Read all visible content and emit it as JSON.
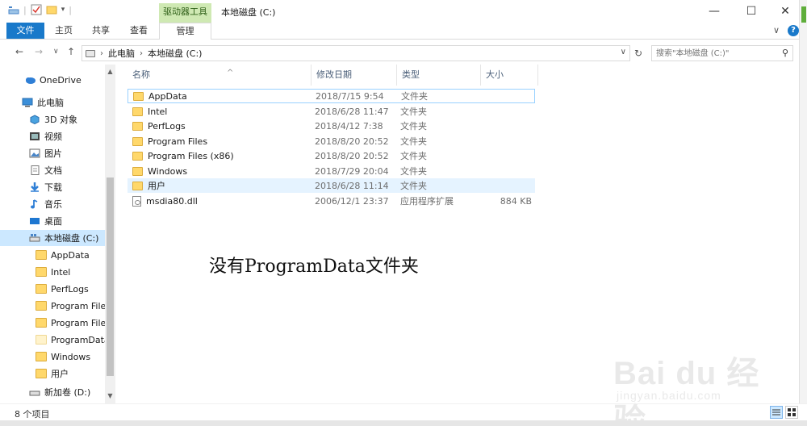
{
  "window": {
    "title": "本地磁盘 (C:)",
    "context_tab_group": "驱动器工具",
    "minimize_glyph": "—",
    "maximize_glyph": "☐",
    "close_glyph": "✕"
  },
  "ribbon": {
    "tabs": [
      "文件",
      "主页",
      "共享",
      "查看",
      "管理"
    ],
    "expand_glyph": "∨",
    "help_glyph": "?"
  },
  "address": {
    "back_glyph": "←",
    "forward_glyph": "→",
    "recent_glyph": "∨",
    "up_glyph": "↑",
    "crumbs": [
      "此电脑",
      "本地磁盘 (C:)"
    ],
    "crumb_sep": "›",
    "dropdown_glyph": "∨",
    "refresh_glyph": "↻",
    "search_placeholder": "搜索\"本地磁盘 (C:)\"",
    "search_glyph": "⚲"
  },
  "navpane": {
    "items": [
      {
        "label": "OneDrive",
        "icon": "cloud-icon"
      },
      {
        "label": "此电脑",
        "icon": "computer-icon"
      },
      {
        "label": "3D 对象",
        "icon": "cube-icon"
      },
      {
        "label": "视频",
        "icon": "video-icon"
      },
      {
        "label": "图片",
        "icon": "picture-icon"
      },
      {
        "label": "文档",
        "icon": "document-icon"
      },
      {
        "label": "下载",
        "icon": "download-icon"
      },
      {
        "label": "音乐",
        "icon": "music-icon"
      },
      {
        "label": "桌面",
        "icon": "desktop-icon"
      },
      {
        "label": "本地磁盘 (C:)",
        "icon": "drive-icon"
      },
      {
        "label": "AppData",
        "icon": "folder-icon"
      },
      {
        "label": "Intel",
        "icon": "folder-icon"
      },
      {
        "label": "PerfLogs",
        "icon": "folder-icon"
      },
      {
        "label": "Program Files",
        "icon": "folder-icon"
      },
      {
        "label": "Program Files",
        "icon": "folder-icon"
      },
      {
        "label": "ProgramData",
        "icon": "folder-icon"
      },
      {
        "label": "Windows",
        "icon": "folder-icon"
      },
      {
        "label": "用户",
        "icon": "folder-icon"
      },
      {
        "label": "新加卷 (D:)",
        "icon": "drive-icon"
      }
    ],
    "scroll_up_glyph": "▲",
    "scroll_down_glyph": "▼"
  },
  "columns": {
    "name": "名称",
    "date": "修改日期",
    "type": "类型",
    "size": "大小",
    "sort_glyph": "^"
  },
  "files": [
    {
      "name": "AppData",
      "date": "2018/7/15 9:54",
      "type": "文件夹",
      "size": ""
    },
    {
      "name": "Intel",
      "date": "2018/6/28 11:47",
      "type": "文件夹",
      "size": ""
    },
    {
      "name": "PerfLogs",
      "date": "2018/4/12 7:38",
      "type": "文件夹",
      "size": ""
    },
    {
      "name": "Program Files",
      "date": "2018/8/20 20:52",
      "type": "文件夹",
      "size": ""
    },
    {
      "name": "Program Files (x86)",
      "date": "2018/8/20 20:52",
      "type": "文件夹",
      "size": ""
    },
    {
      "name": "Windows",
      "date": "2018/7/29 20:04",
      "type": "文件夹",
      "size": ""
    },
    {
      "name": "用户",
      "date": "2018/6/28 11:14",
      "type": "文件夹",
      "size": ""
    },
    {
      "name": "msdia80.dll",
      "date": "2006/12/1 23:37",
      "type": "应用程序扩展",
      "size": "884 KB"
    }
  ],
  "annotation": "没有ProgramData文件夹",
  "watermark": {
    "main": "Bai du 经验",
    "sub": "jingyan.baidu.com"
  },
  "status": {
    "item_count": "8 个项目"
  },
  "colors": {
    "accent": "#1979ca",
    "context_tab": "#cfe9b3",
    "selection": "#cce8ff",
    "folder": "#ffd86b"
  }
}
